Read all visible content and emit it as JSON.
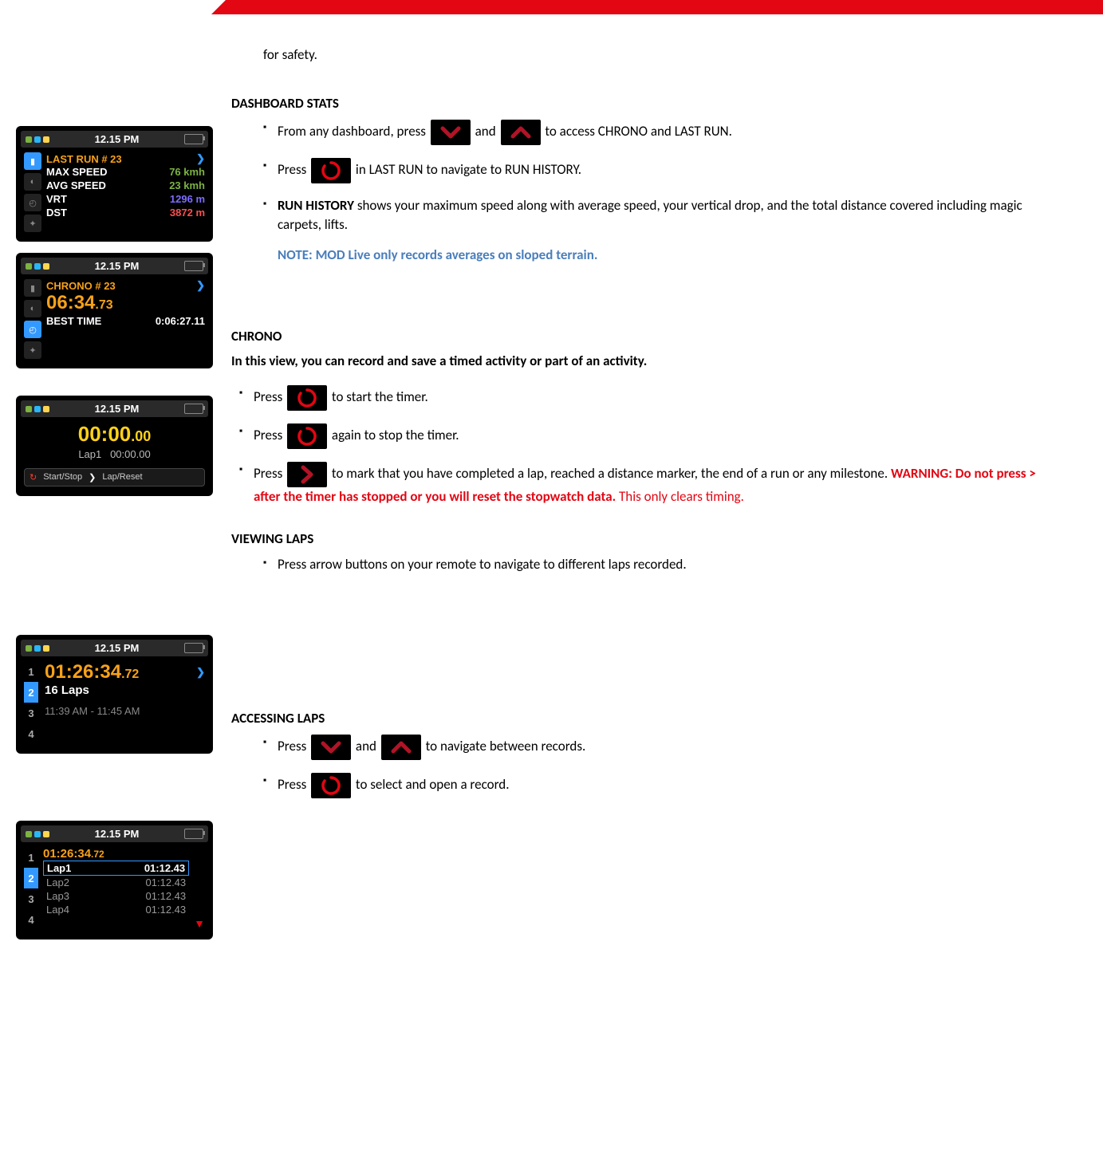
{
  "intro_trailing": "for safety.",
  "sections": {
    "dashboard": {
      "title": "DASHBOARD STATS",
      "b1_a": "From any dashboard, press ",
      "b1_b": " and ",
      "b1_c": " to access CHRONO and LAST RUN.",
      "b2_a": "Press ",
      "b2_b": " in LAST RUN to navigate to RUN HISTORY.",
      "b3_lead": "RUN HISTORY",
      "b3_rest": " shows your maximum speed along with average speed, your vertical drop, and the total distance covered including magic carpets, lifts.",
      "note": "NOTE: MOD Live only records averages on sloped terrain."
    },
    "chrono": {
      "title": "CHRONO",
      "intro": "In this view, you can record and save a timed activity or part of an activity.",
      "b1_a": "Press ",
      "b1_b": " to start the timer.",
      "b2_a": "Press ",
      "b2_b": " again to stop the timer.",
      "b3_a": "Press ",
      "b3_b": " to mark that you have completed a lap, reached a distance marker, the end of a run or any milestone. ",
      "b3_warn": "WARNING: Do not press > after the timer has stopped or you will reset the stopwatch data.",
      "b3_tail": " This only clears timing."
    },
    "viewing": {
      "title": "VIEWING LAPS",
      "b1": "Press arrow buttons on your remote to navigate to different laps recorded."
    },
    "access": {
      "title": "ACCESSING LAPS",
      "b1_a": "Press ",
      "b1_b": " and ",
      "b1_c": " to navigate between records.",
      "b2_a": "Press ",
      "b2_b": " to select and open a record."
    }
  },
  "status_time": "12.15 PM",
  "dev_lastrun": {
    "header": "LAST RUN  # 23",
    "rows": [
      {
        "label": "MAX SPEED",
        "value": "76 kmh",
        "cls": "green"
      },
      {
        "label": "AVG SPEED",
        "value": "23 kmh",
        "cls": "green"
      },
      {
        "label": "VRT",
        "value": "1296 m",
        "cls": "purple"
      },
      {
        "label": "DST",
        "value": "3872 m",
        "cls": "red-v"
      }
    ]
  },
  "dev_chrono_hist": {
    "header": "CHRONO # 23",
    "time": "06:34",
    "frac": ".73",
    "best_label": "BEST TIME",
    "best_value": "0:06:27.11"
  },
  "dev_chrono_timer": {
    "time": "00:00",
    "frac": ".00",
    "lap_label": "Lap1",
    "lap_time": "00:00.00",
    "hint_startstop": "Start/Stop",
    "hint_lapreset": "Lap/Reset"
  },
  "dev_laps_view": {
    "nums": [
      "1",
      "2",
      "3",
      "4"
    ],
    "active": 2,
    "time": "01:26:34",
    "frac": ".72",
    "count": "16 Laps",
    "range": "11:39 AM - 11:45 AM"
  },
  "dev_laps_detail": {
    "nums": [
      "1",
      "2",
      "3",
      "4"
    ],
    "active": 2,
    "header_time": "01:26:34",
    "header_frac": ".72",
    "rows": [
      {
        "label": "Lap1",
        "value": "01:12.43",
        "selected": true
      },
      {
        "label": "Lap2",
        "value": "01:12.43",
        "selected": false
      },
      {
        "label": "Lap3",
        "value": "01:12.43",
        "selected": false
      },
      {
        "label": "Lap4",
        "value": "01:12.43",
        "selected": false
      }
    ]
  }
}
